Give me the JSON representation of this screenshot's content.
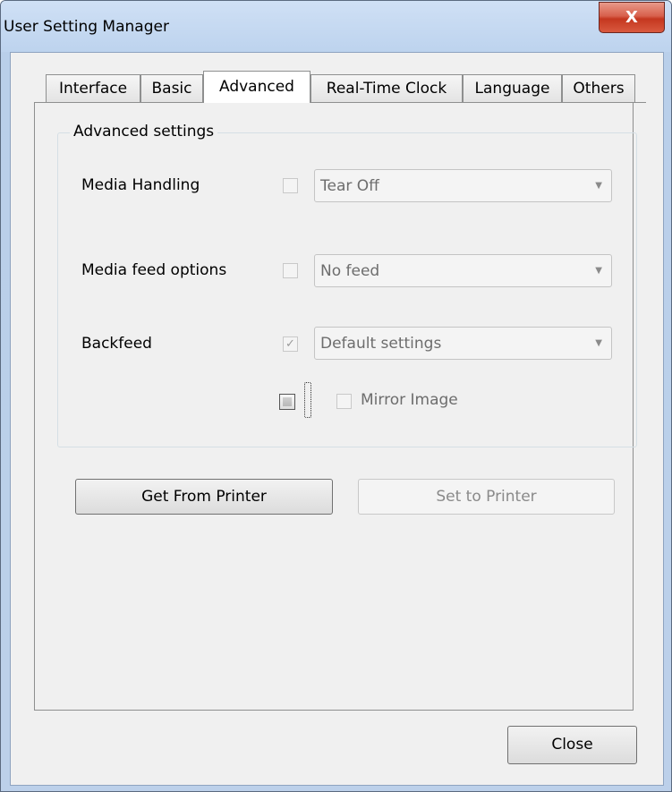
{
  "window": {
    "title": "User Setting Manager",
    "close_glyph": "X"
  },
  "tabs": [
    "Interface",
    "Basic",
    "Advanced",
    "Real-Time Clock",
    "Language",
    "Others"
  ],
  "active_tab": "Advanced",
  "group": {
    "title": "Advanced settings"
  },
  "rows": {
    "media_handling": {
      "label": "Media Handling",
      "checked": false,
      "value": "Tear Off"
    },
    "media_feed": {
      "label": "Media feed options",
      "checked": false,
      "value": "No feed"
    },
    "backfeed": {
      "label": "Backfeed",
      "checked": true,
      "value": "Default settings",
      "check_glyph": "✓"
    },
    "mirror": {
      "label": "Mirror Image",
      "checked": false
    }
  },
  "buttons": {
    "get": "Get From Printer",
    "set": "Set to Printer",
    "close": "Close"
  },
  "icons": {
    "combo_arrow": "▼"
  },
  "colors": {
    "titlebar": "#bdd3ee",
    "close_button": "#c4371f",
    "dialog_bg": "#f0f0f0"
  }
}
